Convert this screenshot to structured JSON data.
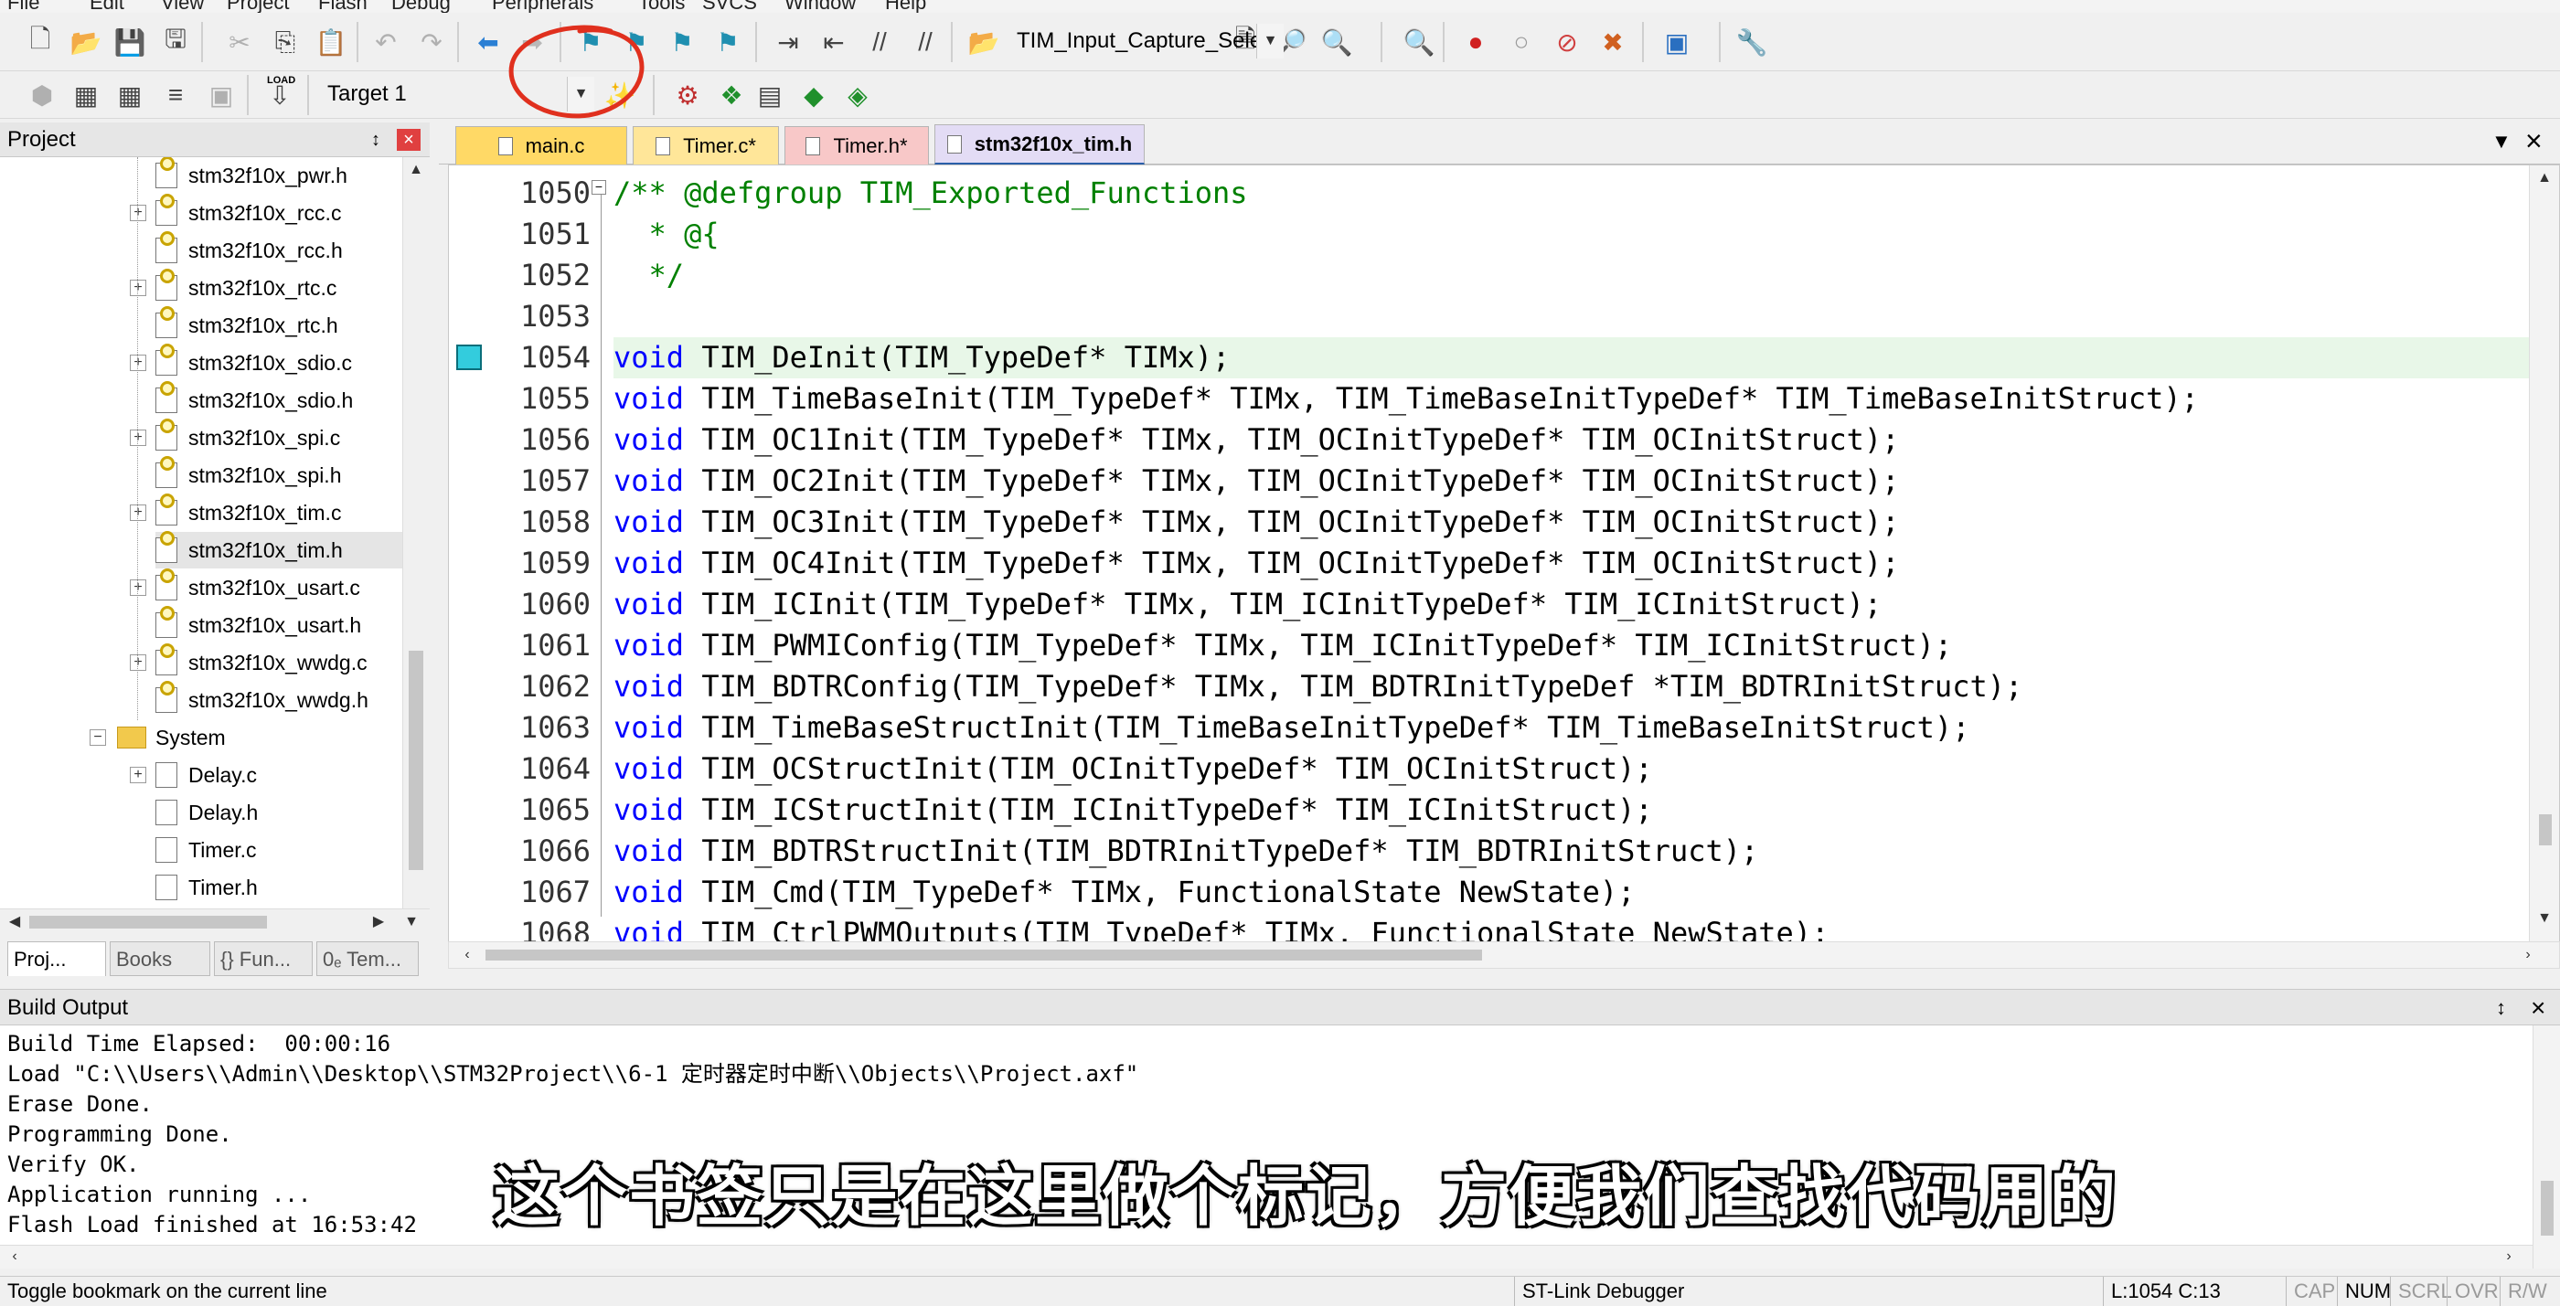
{
  "menubar": [
    "File",
    "Edit",
    "View",
    "Project",
    "Flash",
    "Debug",
    "Peripherals",
    "Tools",
    "SVCS",
    "Window",
    "Help"
  ],
  "toolbar1": {
    "icons": [
      "new-file-icon",
      "open-file-icon",
      "save-icon",
      "save-all-icon",
      "cut-icon",
      "copy-icon",
      "paste-icon",
      "undo-icon",
      "redo-icon",
      "navigate-back-icon",
      "navigate-forward-icon",
      "insert-bookmark-icon",
      "previous-bookmark-icon",
      "next-bookmark-icon",
      "clear-bookmarks-icon",
      "indent-icon",
      "unindent-icon",
      "comment-icon",
      "uncomment-icon",
      "find-in-files-icon",
      "find-icon",
      "incremental-find-icon",
      "debug-session-icon",
      "breakpoint-icon",
      "disable-breakpoint-icon",
      "disable-all-breakpoints-icon",
      "kill-all-breakpoints-icon",
      "window-layout-icon",
      "configure-icon"
    ],
    "find_combo": "TIM_Input_Capture_Selec"
  },
  "toolbar2": {
    "icons": [
      "translate-icon",
      "build-icon",
      "rebuild-icon",
      "batch-build-icon",
      "stop-build-icon",
      "download-icon",
      "options-icon",
      "manage-components-icon",
      "file-extensions-icon",
      "select-packs-icon",
      "pack-installer-icon"
    ],
    "target_label": "LOAD",
    "target_combo": "Target 1"
  },
  "project": {
    "title": "Project",
    "pin": " ⌂",
    "close": "×",
    "tree": [
      {
        "label": "stm32f10x_pwr.h",
        "type": "header",
        "expandable": false
      },
      {
        "label": "stm32f10x_rcc.c",
        "type": "source",
        "expandable": true
      },
      {
        "label": "stm32f10x_rcc.h",
        "type": "header",
        "expandable": false
      },
      {
        "label": "stm32f10x_rtc.c",
        "type": "source",
        "expandable": true
      },
      {
        "label": "stm32f10x_rtc.h",
        "type": "header",
        "expandable": false
      },
      {
        "label": "stm32f10x_sdio.c",
        "type": "source",
        "expandable": true
      },
      {
        "label": "stm32f10x_sdio.h",
        "type": "header",
        "expandable": false
      },
      {
        "label": "stm32f10x_spi.c",
        "type": "source",
        "expandable": true
      },
      {
        "label": "stm32f10x_spi.h",
        "type": "header",
        "expandable": false
      },
      {
        "label": "stm32f10x_tim.c",
        "type": "source",
        "expandable": true
      },
      {
        "label": "stm32f10x_tim.h",
        "type": "header",
        "expandable": false,
        "selected": true
      },
      {
        "label": "stm32f10x_usart.c",
        "type": "source",
        "expandable": true
      },
      {
        "label": "stm32f10x_usart.h",
        "type": "header",
        "expandable": false
      },
      {
        "label": "stm32f10x_wwdg.c",
        "type": "source",
        "expandable": true
      },
      {
        "label": "stm32f10x_wwdg.h",
        "type": "header",
        "expandable": false
      },
      {
        "label": "System",
        "type": "folder",
        "expandable": true,
        "expanded": true
      },
      {
        "label": "Delay.c",
        "type": "plain",
        "expandable": true
      },
      {
        "label": "Delay.h",
        "type": "plain",
        "expandable": false
      },
      {
        "label": "Timer.c",
        "type": "plain",
        "expandable": false
      },
      {
        "label": "Timer.h",
        "type": "plain",
        "expandable": false
      }
    ],
    "tabs": [
      {
        "label": "Proj...",
        "icon": "project-icon"
      },
      {
        "label": "Books",
        "icon": "books-icon"
      },
      {
        "label": "{} Fun...",
        "icon": "functions-icon"
      },
      {
        "label": "0ₑ Tem...",
        "icon": "templates-icon"
      }
    ]
  },
  "editor": {
    "tabs": [
      {
        "label": "main.c",
        "color": "#ffd966"
      },
      {
        "label": "Timer.c*",
        "color": "#ffe699"
      },
      {
        "label": "Timer.h*",
        "color": "#f8c8c8"
      },
      {
        "label": "stm32f10x_tim.h",
        "color": "#e3dcf5",
        "active": true
      }
    ],
    "tab_menu": "▼",
    "tab_close": "×",
    "bookmark_line": 1054,
    "lines": [
      {
        "n": "1050",
        "kw": "",
        "text": "/** @defgroup TIM_Exported_Functions",
        "comment": true
      },
      {
        "n": "1051",
        "kw": "",
        "text": "  * @{",
        "comment": true
      },
      {
        "n": "1052",
        "kw": "",
        "text": "  */",
        "comment": true
      },
      {
        "n": "1053",
        "kw": "",
        "text": "",
        "comment": false
      },
      {
        "n": "1054",
        "kw": "void",
        "text": " TIM_DeInit(TIM_TypeDef* TIMx);",
        "comment": false,
        "current": true
      },
      {
        "n": "1055",
        "kw": "void",
        "text": " TIM_TimeBaseInit(TIM_TypeDef* TIMx, TIM_TimeBaseInitTypeDef* TIM_TimeBaseInitStruct);",
        "comment": false
      },
      {
        "n": "1056",
        "kw": "void",
        "text": " TIM_OC1Init(TIM_TypeDef* TIMx, TIM_OCInitTypeDef* TIM_OCInitStruct);",
        "comment": false
      },
      {
        "n": "1057",
        "kw": "void",
        "text": " TIM_OC2Init(TIM_TypeDef* TIMx, TIM_OCInitTypeDef* TIM_OCInitStruct);",
        "comment": false
      },
      {
        "n": "1058",
        "kw": "void",
        "text": " TIM_OC3Init(TIM_TypeDef* TIMx, TIM_OCInitTypeDef* TIM_OCInitStruct);",
        "comment": false
      },
      {
        "n": "1059",
        "kw": "void",
        "text": " TIM_OC4Init(TIM_TypeDef* TIMx, TIM_OCInitTypeDef* TIM_OCInitStruct);",
        "comment": false
      },
      {
        "n": "1060",
        "kw": "void",
        "text": " TIM_ICInit(TIM_TypeDef* TIMx, TIM_ICInitTypeDef* TIM_ICInitStruct);",
        "comment": false
      },
      {
        "n": "1061",
        "kw": "void",
        "text": " TIM_PWMIConfig(TIM_TypeDef* TIMx, TIM_ICInitTypeDef* TIM_ICInitStruct);",
        "comment": false
      },
      {
        "n": "1062",
        "kw": "void",
        "text": " TIM_BDTRConfig(TIM_TypeDef* TIMx, TIM_BDTRInitTypeDef *TIM_BDTRInitStruct);",
        "comment": false
      },
      {
        "n": "1063",
        "kw": "void",
        "text": " TIM_TimeBaseStructInit(TIM_TimeBaseInitTypeDef* TIM_TimeBaseInitStruct);",
        "comment": false
      },
      {
        "n": "1064",
        "kw": "void",
        "text": " TIM_OCStructInit(TIM_OCInitTypeDef* TIM_OCInitStruct);",
        "comment": false
      },
      {
        "n": "1065",
        "kw": "void",
        "text": " TIM_ICStructInit(TIM_ICInitTypeDef* TIM_ICInitStruct);",
        "comment": false
      },
      {
        "n": "1066",
        "kw": "void",
        "text": " TIM_BDTRStructInit(TIM_BDTRInitTypeDef* TIM_BDTRInitStruct);",
        "comment": false
      },
      {
        "n": "1067",
        "kw": "void",
        "text": " TIM_Cmd(TIM_TypeDef* TIMx, FunctionalState NewState);",
        "comment": false
      },
      {
        "n": "1068",
        "kw": "void",
        "text": " TIM_CtrlPWMOutputs(TIM_TypeDef* TIMx, FunctionalState NewState);",
        "comment": false
      }
    ]
  },
  "build_output": {
    "title": "Build Output",
    "lines": [
      "Build Time Elapsed:  00:00:16",
      "Load \"C:\\\\Users\\\\Admin\\\\Desktop\\\\STM32Project\\\\6-1 定时器定时中断\\\\Objects\\\\Project.axf\"",
      "Erase Done.",
      "Programming Done.",
      "Verify OK.",
      "Application running ...",
      "Flash Load finished at 16:53:42"
    ]
  },
  "subtitle": "这个书签只是在这里做个标记，方便我们查找代码用的",
  "statusbar": {
    "hint": "Toggle bookmark on the current line",
    "debugger": "ST-Link Debugger",
    "position": "L:1054 C:13",
    "indicators": [
      {
        "label": "CAP",
        "on": false
      },
      {
        "label": "NUM",
        "on": true
      },
      {
        "label": "SCRL",
        "on": false
      },
      {
        "label": "OVR",
        "on": false
      },
      {
        "label": "R/W",
        "on": false
      }
    ]
  },
  "colors": {
    "keyword": "#0000ff",
    "comment": "#008000",
    "bookmark": "#33ccdd",
    "annotation": "#e0301e",
    "current_line": "#e8f7e8"
  }
}
